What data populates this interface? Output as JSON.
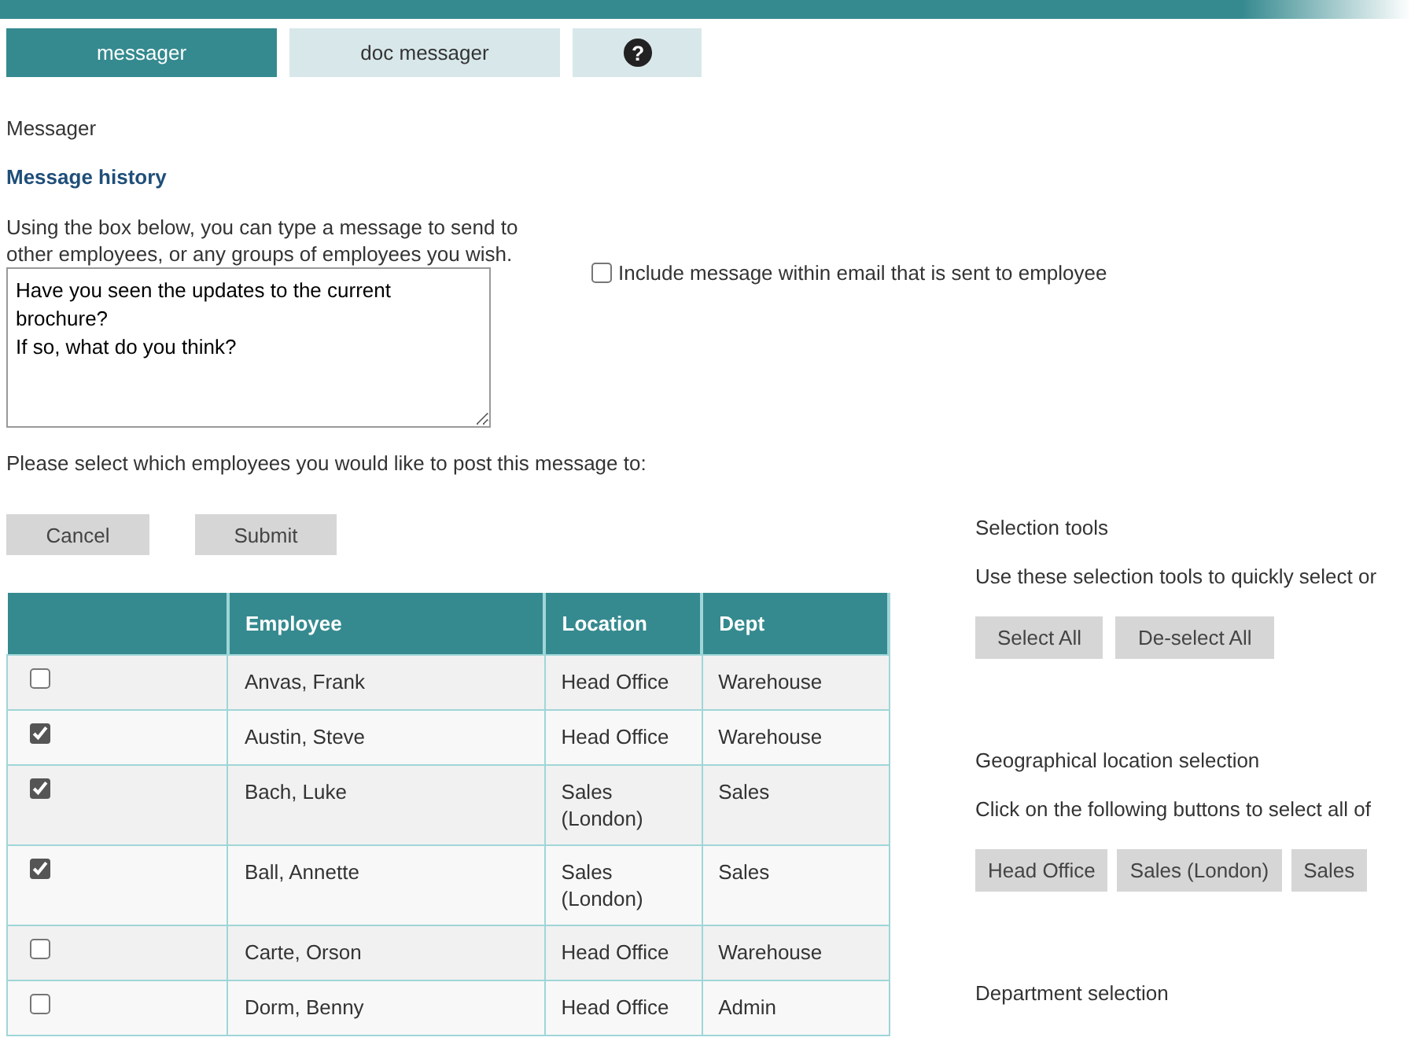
{
  "tabs": [
    {
      "label": "messager",
      "kind": "text",
      "selected": true
    },
    {
      "label": "doc messager",
      "kind": "text",
      "selected": false
    },
    {
      "label": "?",
      "kind": "help",
      "selected": false
    }
  ],
  "page_title": "Messager",
  "section_title": "Message history",
  "intro": "Using the box below, you can type a message to send to other employees, or any groups of employees you wish.",
  "message": {
    "value": "Have you seen the updates to the current brochure?\nIf so, what do you think?"
  },
  "include_email": {
    "label": "Include message within email that is sent to employee",
    "checked": false
  },
  "select_prompt": "Please select which employees you would like to post this message to:",
  "buttons": [
    "Cancel",
    "Submit"
  ],
  "table": {
    "columns": [
      "",
      "Employee",
      "Location",
      "Dept"
    ],
    "rows": [
      {
        "checked": false,
        "employee": "Anvas, Frank",
        "location": "Head Office",
        "dept": "Warehouse"
      },
      {
        "checked": true,
        "employee": "Austin, Steve",
        "location": "Head Office",
        "dept": "Warehouse"
      },
      {
        "checked": true,
        "employee": "Bach, Luke",
        "location": "Sales (London)",
        "dept": "Sales"
      },
      {
        "checked": true,
        "employee": "Ball, Annette",
        "location": "Sales (London)",
        "dept": "Sales"
      },
      {
        "checked": false,
        "employee": "Carte, Orson",
        "location": "Head Office",
        "dept": "Warehouse"
      },
      {
        "checked": false,
        "employee": "Dorm, Benny",
        "location": "Head Office",
        "dept": "Admin"
      }
    ]
  },
  "tools": [
    {
      "title": "Selection tools",
      "text": "Use these selection tools to quickly select or",
      "buttons": [
        "Select All",
        "De-select All"
      ]
    },
    {
      "title": "Geographical location selection",
      "text": "Click on the following buttons to select all of",
      "buttons": [
        "Head Office",
        "Sales (London)",
        "Sales"
      ]
    },
    {
      "title": "Department selection"
    }
  ]
}
